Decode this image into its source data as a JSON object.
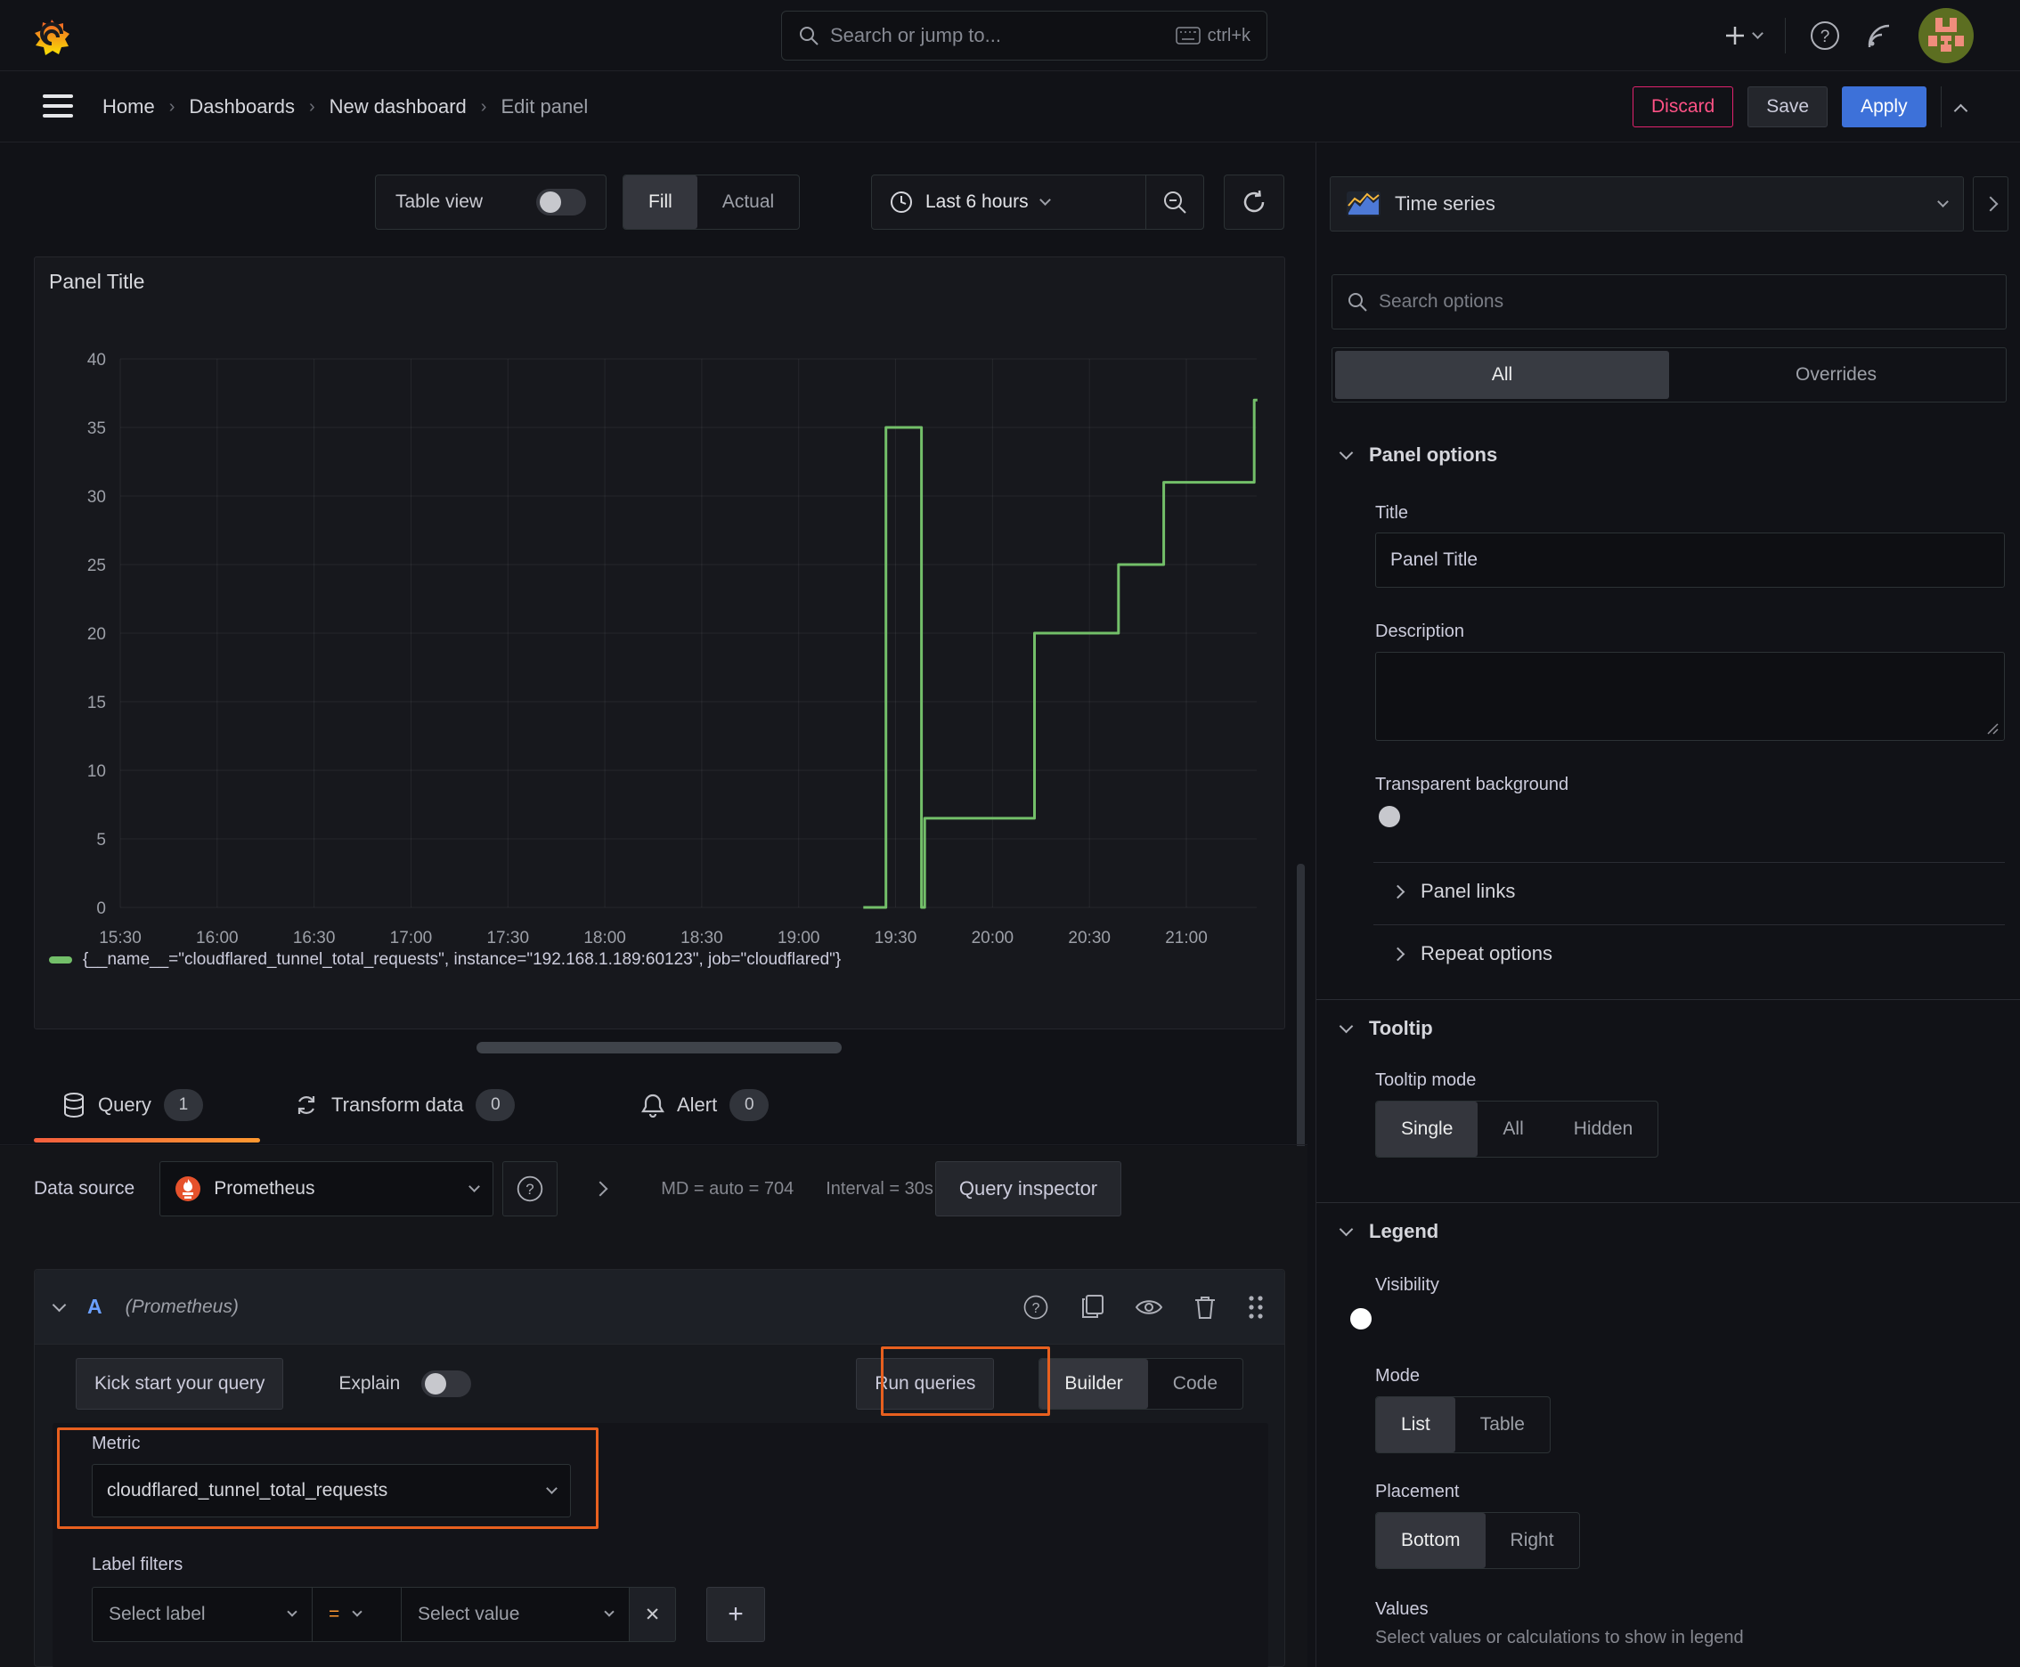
{
  "colors": {
    "accent_orange": "#e8601f",
    "accent_blue": "#3d71d9",
    "discard_pink": "#e0226e",
    "series_green": "#73bf69"
  },
  "topbar": {
    "search_placeholder": "Search or jump to...",
    "shortcut": "ctrl+k"
  },
  "breadcrumb": {
    "home": "Home",
    "dashboards": "Dashboards",
    "new_dashboard": "New dashboard",
    "edit_panel": "Edit panel"
  },
  "actions": {
    "discard": "Discard",
    "save": "Save",
    "apply": "Apply"
  },
  "toolbar": {
    "table_view_label": "Table view",
    "fill": "Fill",
    "actual": "Actual",
    "time_range": "Last 6 hours"
  },
  "panel": {
    "title": "Panel Title"
  },
  "chart_data": {
    "type": "line",
    "line_style": "step-after",
    "title": "Panel Title",
    "xlabel": "",
    "ylabel": "",
    "ylim": [
      0,
      40
    ],
    "grid": true,
    "legend_position": "bottom",
    "x_ticks": [
      "15:30",
      "16:00",
      "16:30",
      "17:00",
      "17:30",
      "18:00",
      "18:30",
      "19:00",
      "19:30",
      "20:00",
      "20:30",
      "21:00"
    ],
    "y_ticks": [
      0,
      5,
      10,
      15,
      20,
      25,
      30,
      35,
      40
    ],
    "end_t": "21:22",
    "series": [
      {
        "name": "{__name__=\"cloudflared_tunnel_total_requests\", instance=\"192.168.1.189:60123\", job=\"cloudflared\"}",
        "color": "#73bf69",
        "points": [
          {
            "t": "19:20",
            "v": 0
          },
          {
            "t": "19:27",
            "v": 35
          },
          {
            "t": "19:38",
            "v": 0
          },
          {
            "t": "19:39",
            "v": 6.5
          },
          {
            "t": "20:13",
            "v": 20
          },
          {
            "t": "20:39",
            "v": 25
          },
          {
            "t": "20:53",
            "v": 31
          },
          {
            "t": "21:21",
            "v": 37
          }
        ]
      }
    ]
  },
  "tabs": {
    "query": {
      "label": "Query",
      "badge": "1"
    },
    "transform": {
      "label": "Transform data",
      "badge": "0"
    },
    "alert": {
      "label": "Alert",
      "badge": "0"
    }
  },
  "query_editor": {
    "datasource_label": "Data source",
    "datasource_value": "Prometheus",
    "stats_md": "MD = auto = 704",
    "stats_interval": "Interval = 30s",
    "query_inspector": "Query inspector",
    "ref_id": "A",
    "ref_ds": "(Prometheus)",
    "kick_start": "Kick start your query",
    "explain": "Explain",
    "run_queries": "Run queries",
    "builder": "Builder",
    "code": "Code",
    "metric_label": "Metric",
    "metric_value": "cloudflared_tunnel_total_requests",
    "label_filters_label": "Label filters",
    "select_label": "Select label",
    "operator": "=",
    "select_value": "Select value",
    "close_glyph": "✕",
    "add_glyph": "+"
  },
  "options_pane": {
    "viz_name": "Time series",
    "search_placeholder": "Search options",
    "tab_all": "All",
    "tab_overrides": "Overrides",
    "panel_options": {
      "heading": "Panel options",
      "title_label": "Title",
      "title_value": "Panel Title",
      "description_label": "Description",
      "transparent_label": "Transparent background"
    },
    "panel_links": "Panel links",
    "repeat_options": "Repeat options",
    "tooltip": {
      "heading": "Tooltip",
      "mode_label": "Tooltip mode",
      "options": [
        "Single",
        "All",
        "Hidden"
      ],
      "selected": "Single"
    },
    "legend": {
      "heading": "Legend",
      "visibility_label": "Visibility",
      "mode_label": "Mode",
      "modes": [
        "List",
        "Table"
      ],
      "placement_label": "Placement",
      "placements": [
        "Bottom",
        "Right"
      ],
      "values_label": "Values",
      "values_desc": "Select values or calculations to show in legend"
    }
  }
}
